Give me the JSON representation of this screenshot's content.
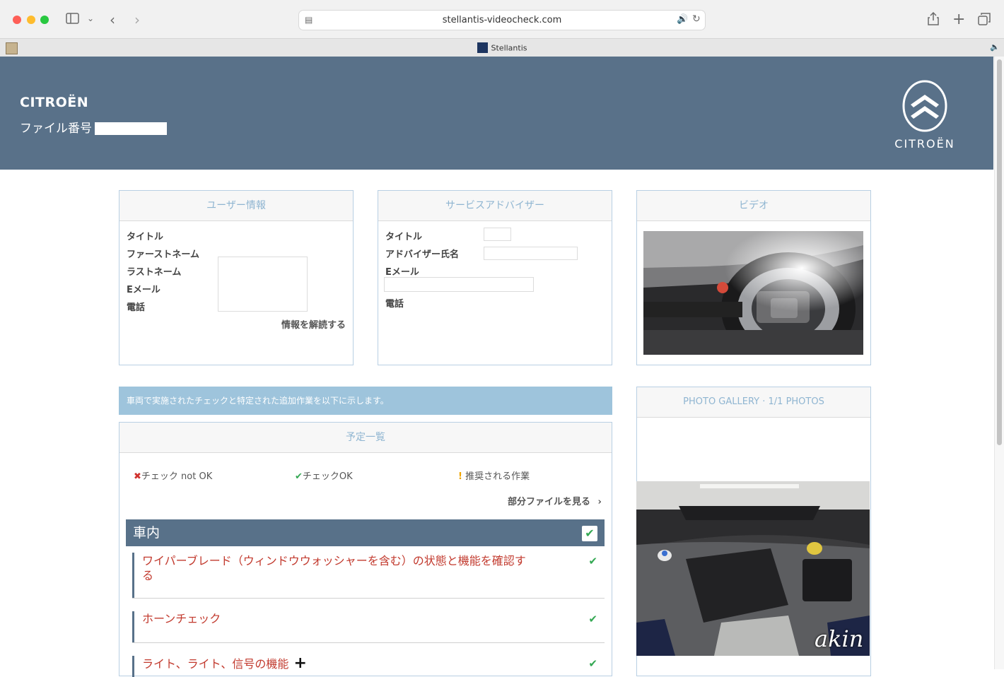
{
  "browser": {
    "url": "stellantis-videocheck.com",
    "tab_title": "Stellantis"
  },
  "header": {
    "brand": "CITROËN",
    "file_label": "ファイル番号",
    "logo_text": "CITROËN"
  },
  "user_info": {
    "title": "ユーザー情報",
    "fields": [
      "タイトル",
      "ファーストネーム",
      "ラストネーム",
      "Eメール",
      "電話"
    ],
    "unlock_label": "情報を解読する"
  },
  "advisor": {
    "title": "サービスアドバイザー",
    "fields": [
      "タイトル",
      "アドバイザー氏名",
      "Eメール",
      "電話"
    ]
  },
  "video": {
    "title": "ビデオ"
  },
  "banner": {
    "text": "車両で実施されたチェックと特定された追加作業を以下に示します。"
  },
  "schedule": {
    "title": "予定一覧",
    "legend": {
      "not_ok": "チェック not OK",
      "ok": "チェックOK",
      "recommended": "推奨される作業"
    },
    "partial_link": "部分ファイルを見る",
    "category": "車内",
    "items": [
      {
        "label": "ワイパーブレード（ウィンドウウォッシャーを含む）の状態と機能を確認する"
      },
      {
        "label": "ホーンチェック"
      },
      {
        "label": "ライト、ライト、信号の機能"
      }
    ]
  },
  "gallery": {
    "title": "PHOTO GALLERY · 1/1 PHOTOS"
  },
  "watermark": "akin"
}
